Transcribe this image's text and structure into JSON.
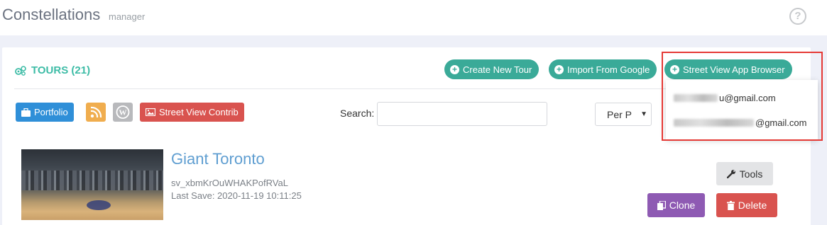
{
  "header": {
    "title": "Constellations",
    "subtitle": "manager",
    "help_icon": "question-circle-icon"
  },
  "tours": {
    "title": "TOURS (21)",
    "icon": "cogs-icon"
  },
  "actions": {
    "create": "Create New Tour",
    "import": "Import From Google",
    "browser": "Street View App Browser"
  },
  "toolbar": {
    "portfolio": "Portfolio",
    "rss_icon": "rss-icon",
    "wordpress_icon": "wordpress-icon",
    "contrib": "Street View Contrib",
    "search_label": "Search:",
    "search_value": "",
    "per_page": "Per P"
  },
  "dropdown": {
    "accounts": [
      {
        "email_visible": "u@gmail.com"
      },
      {
        "email_visible": "@gmail.com"
      }
    ]
  },
  "tour": {
    "name": "Giant Toronto",
    "id": "sv_xbmKrOuWHAKPofRVaL",
    "last_save": "Last Save: 2020-11-19 10:11:25",
    "tools": "Tools",
    "clone": "Clone",
    "delete": "Delete"
  },
  "colors": {
    "teal": "#3aaa98",
    "blue": "#2f8fd8",
    "red": "#d9534f",
    "purple": "#8e5ab3",
    "orange": "#f0ad4e",
    "highlight": "#e53935"
  }
}
